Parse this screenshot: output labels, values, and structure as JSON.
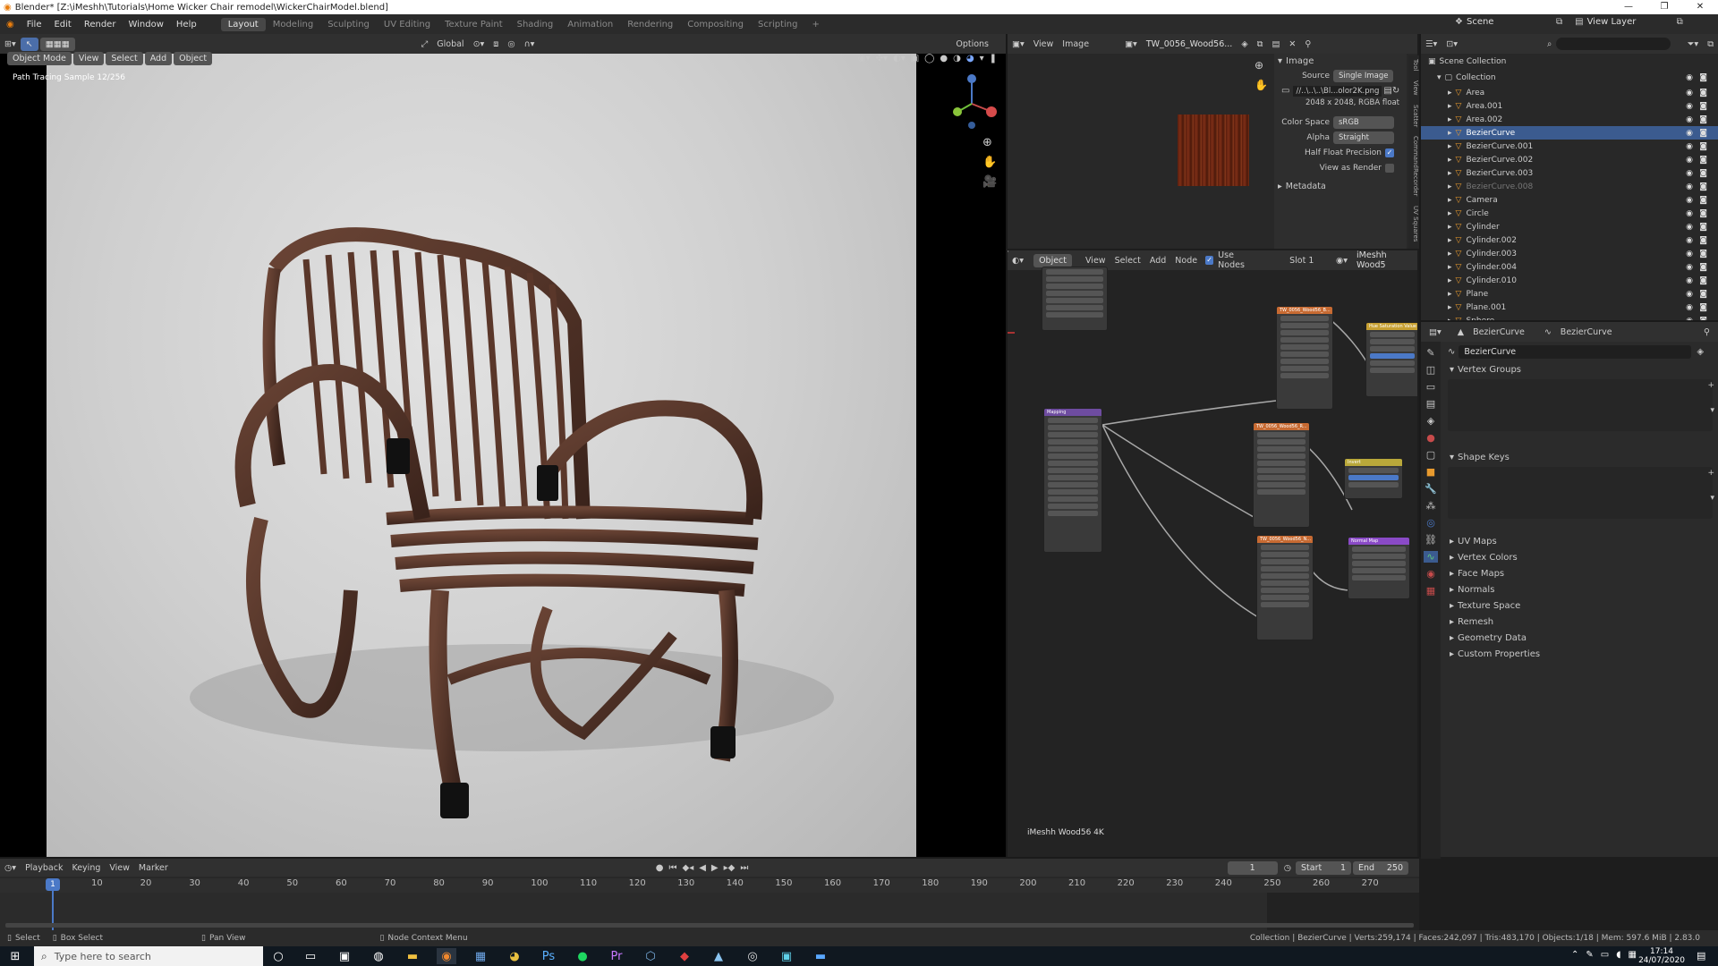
{
  "window": {
    "title": "Blender* [Z:\\iMeshh\\Tutorials\\Home Wicker Chair remodel\\WickerChairModel.blend]",
    "controls": [
      "—",
      "❐",
      "✕"
    ]
  },
  "menubar": {
    "menus": [
      "File",
      "Edit",
      "Render",
      "Window",
      "Help"
    ],
    "workspaces": [
      "Layout",
      "Modeling",
      "Sculpting",
      "UV Editing",
      "Texture Paint",
      "Shading",
      "Animation",
      "Rendering",
      "Compositing",
      "Scripting"
    ],
    "active_workspace": "Layout",
    "scene": "Scene",
    "view_layer": "View Layer"
  },
  "viewport": {
    "mode": "Object Mode",
    "menus": [
      "View",
      "Select",
      "Add",
      "Object"
    ],
    "orientation": "Global",
    "options": "Options",
    "overlay_text": "Path Tracing Sample 12/256"
  },
  "image_editor": {
    "menus": [
      "View",
      "Image"
    ],
    "image_name": "TW_0056_Wood56...",
    "panel_title": "Image",
    "source_label": "Source",
    "source_value": "Single Image",
    "file_path": "//..\\..\\..\\Bl...olor2K.png",
    "resolution": "2048 x 2048,  RGBA float",
    "color_space_label": "Color Space",
    "color_space_value": "sRGB",
    "alpha_label": "Alpha",
    "alpha_value": "Straight",
    "half_float_label": "Half Float Precision",
    "view_as_render_label": "View as Render",
    "metadata_label": "Metadata",
    "side_tabs": [
      "Tool",
      "View",
      "Scatter",
      "CommandRecorder",
      "UV Squares"
    ]
  },
  "node_editor": {
    "object_label": "Object",
    "menus": [
      "View",
      "Select",
      "Add",
      "Node"
    ],
    "use_nodes_label": "Use Nodes",
    "slot": "Slot 1",
    "material": "iMeshh Wood5",
    "footer_label": "iMeshh Wood56 4K",
    "nodes": {
      "mapping": "Mapping",
      "tex1": "TW_0056_Wood56_B...",
      "tex2": "TW_0056_Wood56_R...",
      "tex3": "TW_0056_Wood56_N...",
      "hsv": "Hue Saturation Value",
      "invert": "Invert",
      "normal_map": "Normal Map"
    }
  },
  "outliner": {
    "root": "Scene Collection",
    "collection": "Collection",
    "items": [
      {
        "name": "Area",
        "selected": false,
        "dim": false
      },
      {
        "name": "Area.001",
        "selected": false,
        "dim": false
      },
      {
        "name": "Area.002",
        "selected": false,
        "dim": false
      },
      {
        "name": "BezierCurve",
        "selected": true,
        "dim": false
      },
      {
        "name": "BezierCurve.001",
        "selected": false,
        "dim": false
      },
      {
        "name": "BezierCurve.002",
        "selected": false,
        "dim": false
      },
      {
        "name": "BezierCurve.003",
        "selected": false,
        "dim": false
      },
      {
        "name": "BezierCurve.008",
        "selected": false,
        "dim": true
      },
      {
        "name": "Camera",
        "selected": false,
        "dim": false
      },
      {
        "name": "Circle",
        "selected": false,
        "dim": false
      },
      {
        "name": "Cylinder",
        "selected": false,
        "dim": false
      },
      {
        "name": "Cylinder.002",
        "selected": false,
        "dim": false
      },
      {
        "name": "Cylinder.003",
        "selected": false,
        "dim": false
      },
      {
        "name": "Cylinder.004",
        "selected": false,
        "dim": false
      },
      {
        "name": "Cylinder.010",
        "selected": false,
        "dim": false
      },
      {
        "name": "Plane",
        "selected": false,
        "dim": false
      },
      {
        "name": "Plane.001",
        "selected": false,
        "dim": false
      },
      {
        "name": "Sphere",
        "selected": false,
        "dim": false
      }
    ]
  },
  "properties": {
    "breadcrumb_object": "BezierCurve",
    "breadcrumb_data": "BezierCurve",
    "data_name": "BezierCurve",
    "panels": {
      "vertex_groups": "Vertex Groups",
      "shape_keys": "Shape Keys"
    },
    "collapsed": [
      "UV Maps",
      "Vertex Colors",
      "Face Maps",
      "Normals",
      "Texture Space",
      "Remesh",
      "Geometry Data",
      "Custom Properties"
    ]
  },
  "timeline": {
    "menus": [
      "Playback",
      "Keying",
      "View",
      "Marker"
    ],
    "current_frame": "1",
    "start_label": "Start",
    "start": "1",
    "end_label": "End",
    "end": "250",
    "ticks": [
      "1",
      "10",
      "20",
      "30",
      "40",
      "50",
      "60",
      "70",
      "80",
      "90",
      "100",
      "110",
      "120",
      "130",
      "140",
      "150",
      "160",
      "170",
      "180",
      "190",
      "200",
      "210",
      "220",
      "230",
      "240",
      "250",
      "260",
      "270"
    ]
  },
  "statusbar": {
    "select": "Select",
    "box_select": "Box Select",
    "pan_view": "Pan View",
    "context_menu": "Node Context Menu",
    "stats": "Collection | BezierCurve | Verts:259,174 | Faces:242,097 | Tris:483,170 | Objects:1/18 | Mem: 597.6 MiB | 2.83.0"
  },
  "taskbar": {
    "search_placeholder": "Type here to search",
    "time": "17:14",
    "date": "24/07/2020"
  },
  "colors": {
    "accent_selection": "#3b5b8f",
    "viewport_bg": "#000000",
    "panel_bg": "#303030"
  }
}
